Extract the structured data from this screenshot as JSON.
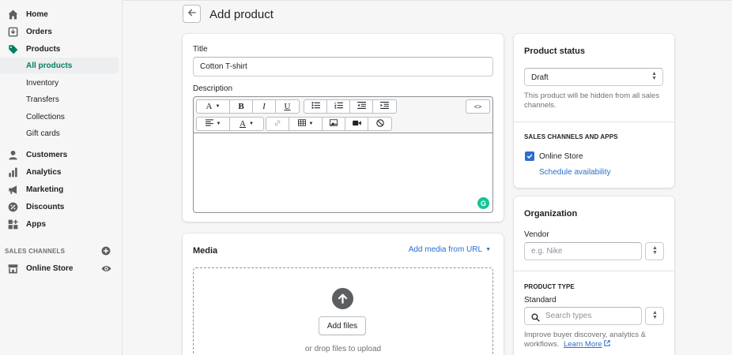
{
  "sidebar": {
    "items": [
      {
        "label": "Home",
        "icon": "home-icon"
      },
      {
        "label": "Orders",
        "icon": "orders-icon"
      },
      {
        "label": "Products",
        "icon": "tag-icon"
      },
      {
        "label": "Customers",
        "icon": "person-icon"
      },
      {
        "label": "Analytics",
        "icon": "bar-chart-icon"
      },
      {
        "label": "Marketing",
        "icon": "megaphone-icon"
      },
      {
        "label": "Discounts",
        "icon": "discount-icon"
      },
      {
        "label": "Apps",
        "icon": "apps-icon"
      }
    ],
    "products_sub": [
      {
        "label": "All products",
        "active": true
      },
      {
        "label": "Inventory"
      },
      {
        "label": "Transfers"
      },
      {
        "label": "Collections"
      },
      {
        "label": "Gift cards"
      }
    ],
    "sales_channels_label": "SALES CHANNELS",
    "online_store_label": "Online Store"
  },
  "header": {
    "title": "Add product"
  },
  "product_card": {
    "title_label": "Title",
    "title_value": "Cotton T-shirt",
    "description_label": "Description",
    "grammarly_badge": "G",
    "toolbar": {
      "font_label": "A",
      "bold": "B",
      "italic": "I",
      "underline": "U",
      "html": "<>",
      "color_label": "A"
    }
  },
  "media_card": {
    "title": "Media",
    "add_url_label": "Add media from URL",
    "add_files_label": "Add files",
    "drop_hint": "or drop files to upload"
  },
  "status_card": {
    "title": "Product status",
    "status_value": "Draft",
    "status_help": "This product will be hidden from all sales channels.",
    "channels_heading": "SALES CHANNELS AND APPS",
    "channel_label": "Online Store",
    "channel_checked": true,
    "schedule_link": "Schedule availability"
  },
  "organization_card": {
    "title": "Organization",
    "vendor_label": "Vendor",
    "vendor_placeholder": "e.g. Nike",
    "product_type_heading": "PRODUCT TYPE",
    "product_type_value": "Standard",
    "search_placeholder": "Search types",
    "help_text": "Improve buyer discovery, analytics & workflows.",
    "learn_more": "Learn More"
  },
  "colors": {
    "accent_green": "#008060",
    "link_blue": "#2c6ecb",
    "checkbox_blue": "#2c6ecb"
  }
}
